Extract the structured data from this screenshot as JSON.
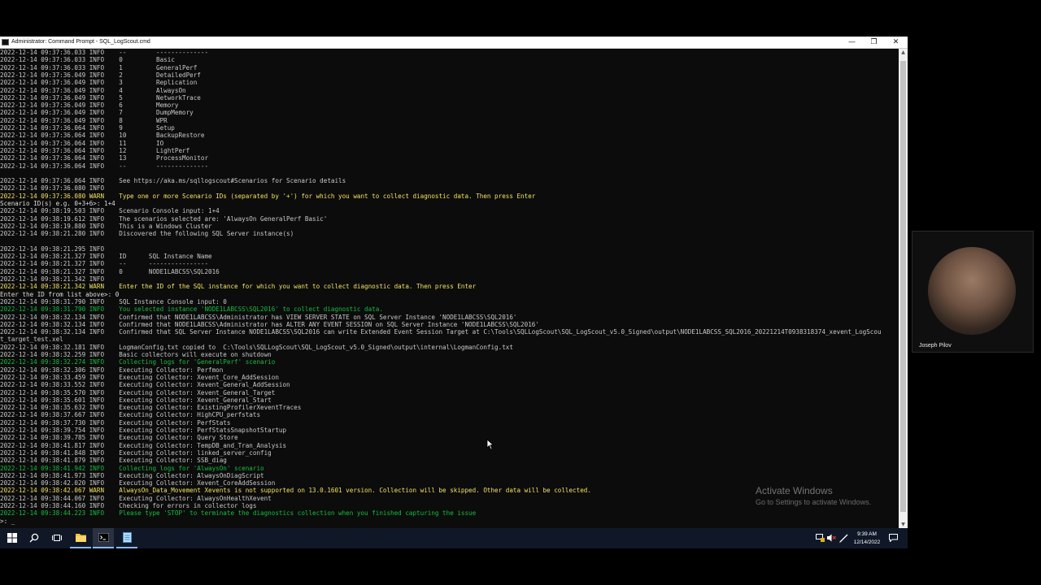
{
  "window": {
    "title": "Administrator: Command Prompt - SQL_LogScout.cmd",
    "minimize_glyph": "—",
    "restore_glyph": "❐",
    "close_glyph": "✕"
  },
  "colors": {
    "info": "#c9c9c9",
    "warn": "#f2e35c",
    "green": "#13bf3f",
    "console_bg": "#0c0c0c"
  },
  "console": {
    "lines": [
      {
        "text": "2022-12-14 09:37:36.033 INFO    --        --------------",
        "kind": "info"
      },
      {
        "text": "2022-12-14 09:37:36.033 INFO    0         Basic",
        "kind": "info"
      },
      {
        "text": "2022-12-14 09:37:36.033 INFO    1         GeneralPerf",
        "kind": "info"
      },
      {
        "text": "2022-12-14 09:37:36.049 INFO    2         DetailedPerf",
        "kind": "info"
      },
      {
        "text": "2022-12-14 09:37:36.049 INFO    3         Replication",
        "kind": "info"
      },
      {
        "text": "2022-12-14 09:37:36.049 INFO    4         AlwaysOn",
        "kind": "info"
      },
      {
        "text": "2022-12-14 09:37:36.049 INFO    5         NetworkTrace",
        "kind": "info"
      },
      {
        "text": "2022-12-14 09:37:36.049 INFO    6         Memory",
        "kind": "info"
      },
      {
        "text": "2022-12-14 09:37:36.049 INFO    7         DumpMemory",
        "kind": "info"
      },
      {
        "text": "2022-12-14 09:37:36.049 INFO    8         WPR",
        "kind": "info"
      },
      {
        "text": "2022-12-14 09:37:36.064 INFO    9         Setup",
        "kind": "info"
      },
      {
        "text": "2022-12-14 09:37:36.064 INFO    10        BackupRestore",
        "kind": "info"
      },
      {
        "text": "2022-12-14 09:37:36.064 INFO    11        IO",
        "kind": "info"
      },
      {
        "text": "2022-12-14 09:37:36.064 INFO    12        LightPerf",
        "kind": "info"
      },
      {
        "text": "2022-12-14 09:37:36.064 INFO    13        ProcessMonitor",
        "kind": "info"
      },
      {
        "text": "2022-12-14 09:37:36.064 INFO    --        --------------",
        "kind": "info"
      },
      {
        "text": "",
        "kind": "info"
      },
      {
        "text": "2022-12-14 09:37:36.064 INFO    See https://aka.ms/sqllogscout#Scenarios for Scenario details",
        "kind": "info"
      },
      {
        "text": "2022-12-14 09:37:36.080 INFO",
        "kind": "info"
      },
      {
        "text": "2022-12-14 09:37:36.080 WARN    Type one or more Scenario IDs (separated by '+') for which you want to collect diagnostic data. Then press Enter",
        "kind": "warn"
      },
      {
        "text": "Scenario ID(s) e.g. 0+3+6>: 1+4",
        "kind": "prompt"
      },
      {
        "text": "2022-12-14 09:38:19.503 INFO    Scenario Console input: 1+4",
        "kind": "info"
      },
      {
        "text": "2022-12-14 09:38:19.612 INFO    The scenarios selected are: 'AlwaysOn GeneralPerf Basic'",
        "kind": "info"
      },
      {
        "text": "2022-12-14 09:38:19.880 INFO    This is a Windows Cluster",
        "kind": "info"
      },
      {
        "text": "2022-12-14 09:38:21.280 INFO    Discovered the following SQL Server instance(s)",
        "kind": "info"
      },
      {
        "text": "",
        "kind": "info"
      },
      {
        "text": "2022-12-14 09:38:21.295 INFO",
        "kind": "info"
      },
      {
        "text": "2022-12-14 09:38:21.327 INFO    ID      SQL Instance Name",
        "kind": "info"
      },
      {
        "text": "2022-12-14 09:38:21.327 INFO    --      ----------------",
        "kind": "info"
      },
      {
        "text": "2022-12-14 09:38:21.327 INFO    0       NODE1LABCSS\\SQL2016",
        "kind": "info"
      },
      {
        "text": "2022-12-14 09:38:21.342 INFO",
        "kind": "info"
      },
      {
        "text": "2022-12-14 09:38:21.342 WARN    Enter the ID of the SQL instance for which you want to collect diagnostic data. Then press Enter",
        "kind": "warn"
      },
      {
        "text": "Enter the ID from list above>: 0",
        "kind": "prompt"
      },
      {
        "text": "2022-12-14 09:38:31.790 INFO    SQL Instance Console input: 0",
        "kind": "info"
      },
      {
        "text": "2022-12-14 09:38:31.790 INFO    You selected instance 'NODE1LABCSS\\SQL2016' to collect diagnostic data.",
        "kind": "green"
      },
      {
        "text": "2022-12-14 09:38:32.134 INFO    Confirmed that NODE1LABCSS\\Administrator has VIEW SERVER STATE on SQL Server Instance 'NODE1LABCSS\\SQL2016'",
        "kind": "info"
      },
      {
        "text": "2022-12-14 09:38:32.134 INFO    Confirmed that NODE1LABCSS\\Administrator has ALTER ANY EVENT SESSION on SQL Server Instance 'NODE1LABCSS\\SQL2016'",
        "kind": "info"
      },
      {
        "text": "2022-12-14 09:38:32.134 INFO    Confirmed that SQL Server Instance NODE1LABCSS\\SQL2016 can write Extended Event Session Target at C:\\Tools\\SQLLogScout\\SQL_LogScout_v5.0_Signed\\output\\NODE1LABCSS_SQL2016_20221214T0938318374_xevent_LogScou",
        "kind": "info"
      },
      {
        "text": "t_target_test.xel",
        "kind": "info"
      },
      {
        "text": "2022-12-14 09:38:32.181 INFO    LogmanConfig.txt copied to  C:\\Tools\\SQLLogScout\\SQL_LogScout_v5.0_Signed\\output\\internal\\LogmanConfig.txt",
        "kind": "info"
      },
      {
        "text": "2022-12-14 09:38:32.259 INFO    Basic collectors will execute on shutdown",
        "kind": "info"
      },
      {
        "text": "2022-12-14 09:38:32.274 INFO    Collecting logs for 'GeneralPerf' scenario",
        "kind": "green"
      },
      {
        "text": "2022-12-14 09:38:32.306 INFO    Executing Collector: Perfmon",
        "kind": "info"
      },
      {
        "text": "2022-12-14 09:38:33.459 INFO    Executing Collector: Xevent_Core_AddSession",
        "kind": "info"
      },
      {
        "text": "2022-12-14 09:38:33.552 INFO    Executing Collector: Xevent_General_AddSession",
        "kind": "info"
      },
      {
        "text": "2022-12-14 09:38:35.570 INFO    Executing Collector: Xevent_General_Target",
        "kind": "info"
      },
      {
        "text": "2022-12-14 09:38:35.601 INFO    Executing Collector: Xevent_General_Start",
        "kind": "info"
      },
      {
        "text": "2022-12-14 09:38:35.632 INFO    Executing Collector: ExistingProfilerXeventTraces",
        "kind": "info"
      },
      {
        "text": "2022-12-14 09:38:37.667 INFO    Executing Collector: HighCPU_perfstats",
        "kind": "info"
      },
      {
        "text": "2022-12-14 09:38:37.730 INFO    Executing Collector: PerfStats",
        "kind": "info"
      },
      {
        "text": "2022-12-14 09:38:39.754 INFO    Executing Collector: PerfStatsSnapshotStartup",
        "kind": "info"
      },
      {
        "text": "2022-12-14 09:38:39.785 INFO    Executing Collector: Query Store",
        "kind": "info"
      },
      {
        "text": "2022-12-14 09:38:41.817 INFO    Executing Collector: TempDB_and_Tran_Analysis",
        "kind": "info"
      },
      {
        "text": "2022-12-14 09:38:41.848 INFO    Executing Collector: linked_server_config",
        "kind": "info"
      },
      {
        "text": "2022-12-14 09:38:41.879 INFO    Executing Collector: SSB_diag",
        "kind": "info"
      },
      {
        "text": "2022-12-14 09:38:41.942 INFO    Collecting logs for 'AlwaysOn' scenario",
        "kind": "green"
      },
      {
        "text": "2022-12-14 09:38:41.973 INFO    Executing Collector: AlwaysOnDiagScript",
        "kind": "info"
      },
      {
        "text": "2022-12-14 09:38:42.020 INFO    Executing Collector: Xevent_CoreAddSession",
        "kind": "info"
      },
      {
        "text": "2022-12-14 09:38:42.067 WARN    AlwaysOn_Data_Movement Xevents is not supported on 13.0.1601 version. Collection will be skipped. Other data will be collected.",
        "kind": "warn"
      },
      {
        "text": "2022-12-14 09:38:44.067 INFO    Executing Collector: AlwaysOnHealthXevent",
        "kind": "info"
      },
      {
        "text": "2022-12-14 09:38:44.160 INFO    Checking for errors in collector logs",
        "kind": "info"
      },
      {
        "text": "2022-12-14 09:38:44.223 INFO    Please type 'STOP' to terminate the diagnostics collection when you finished capturing the issue",
        "kind": "green"
      },
      {
        "text": ">: _",
        "kind": "prompt"
      }
    ]
  },
  "watermark": {
    "title": "Activate Windows",
    "subtitle": "Go to Settings to activate Windows."
  },
  "taskbar": {
    "start_icon": "windows-start-icon",
    "search_icon": "search-icon",
    "taskview_icon": "task-view-icon",
    "apps": [
      {
        "name": "file-explorer-icon",
        "active": false
      },
      {
        "name": "command-prompt-icon",
        "active": true
      },
      {
        "name": "notepad-app-icon",
        "active": false
      }
    ],
    "clock_time": "9:39 AM",
    "clock_date": "12/14/2022"
  },
  "webcam": {
    "name": "Joseph Pilov"
  }
}
